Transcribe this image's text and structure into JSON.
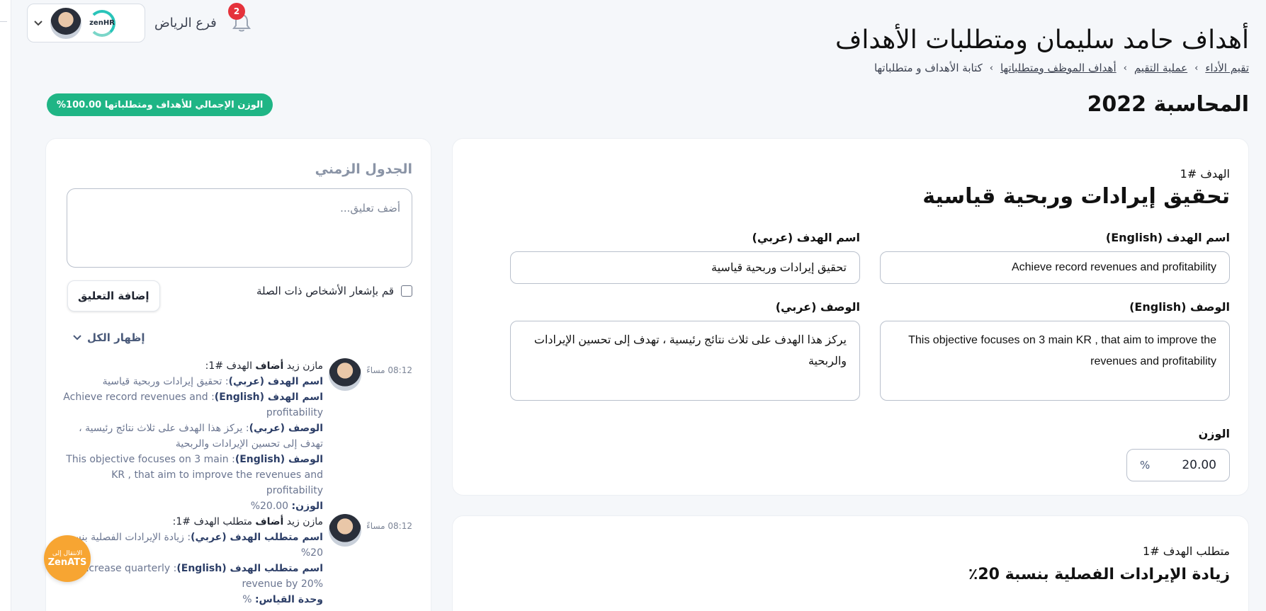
{
  "header": {
    "title": "أهداف حامد سليمان ومتطلبات الأهداف",
    "breadcrumb": [
      "تقيم الأداء",
      "عملية التقيم",
      "أهداف الموظف ومتطلباتها",
      "كتابة الأهداف و متطلباتها"
    ],
    "cycle_title": "المحاسبة 2022",
    "total_weight_badge": "الوزن الإجمالي للأهداف ومتطلباتها 100.00%"
  },
  "topbar": {
    "branch": "فرع الرياض",
    "logo_text": "zenHR",
    "notification_count": "2"
  },
  "goal": {
    "number_label": "الهدف #1",
    "title": "تحقيق إيرادات وربحية قياسية",
    "name_en_label": "اسم الهدف (English)",
    "name_en_value": "Achieve record revenues and profitability",
    "name_ar_label": "اسم الهدف (عربي)",
    "name_ar_value": "تحقيق إيرادات وربحية قياسية",
    "desc_en_label": "الوصف (English)",
    "desc_en_value": "This objective focuses on 3 main KR , that aim to improve the revenues and profitability",
    "desc_ar_label": "الوصف (عربي)",
    "desc_ar_value": "يركز هذا الهدف على ثلاث نتائج رئيسية ، تهدف إلى تحسين الإيرادات والربحية",
    "weight_label": "الوزن",
    "weight_value": "20.00",
    "weight_unit": "%"
  },
  "requirement": {
    "number_label": "متطلب الهدف #1",
    "title": "زيادة الإيرادات الفصلية بنسبة 20٪"
  },
  "timeline": {
    "title": "الجدول الزمني",
    "comment_placeholder": "أضف تعليق...",
    "notify_label": "قم بإشعار الأشخاص ذات الصلة",
    "add_button": "إضافة التعليق",
    "show_all": "إظهار الكل",
    "entries": [
      {
        "time": "08:12 مساءً",
        "author": "مازن زيد",
        "action": "أضاف",
        "target": "الهدف #1:",
        "lines": [
          {
            "key": "اسم الهدف (عربي)",
            "value": ": تحقيق إيرادات وربحية قياسية"
          },
          {
            "key": "اسم الهدف (English)",
            "value": ": Achieve record revenues and profitability"
          },
          {
            "key": "الوصف (عربي)",
            "value": ": يركز هذا الهدف على ثلاث نتائج رئيسية ، تهدف إلى تحسين الإيرادات والربحية"
          },
          {
            "key": "الوصف (English)",
            "value": ": This objective focuses on 3 main KR , that aim to improve the revenues and profitability"
          },
          {
            "key": "الوزن:",
            "value": " 20.00%"
          }
        ]
      },
      {
        "time": "08:12 مساءً",
        "author": "مازن زيد",
        "action": "أضاف",
        "target": "متطلب الهدف #1:",
        "lines": [
          {
            "key": "اسم متطلب الهدف (عربي)",
            "value": ": زيادة الإيرادات الفصلية بنسبة 20%"
          },
          {
            "key": "اسم متطلب الهدف (English)",
            "value": ": increase quarterly revenue by 20%"
          },
          {
            "key": "وحدة القياس:",
            "value": " %"
          }
        ]
      }
    ]
  },
  "ats_button": {
    "line1": "الانتقال إلى",
    "line2": "ZenATS"
  },
  "colors": {
    "accent_green": "#1fb585",
    "badge_red": "#e5323b",
    "ats_orange": "#f7a532"
  }
}
